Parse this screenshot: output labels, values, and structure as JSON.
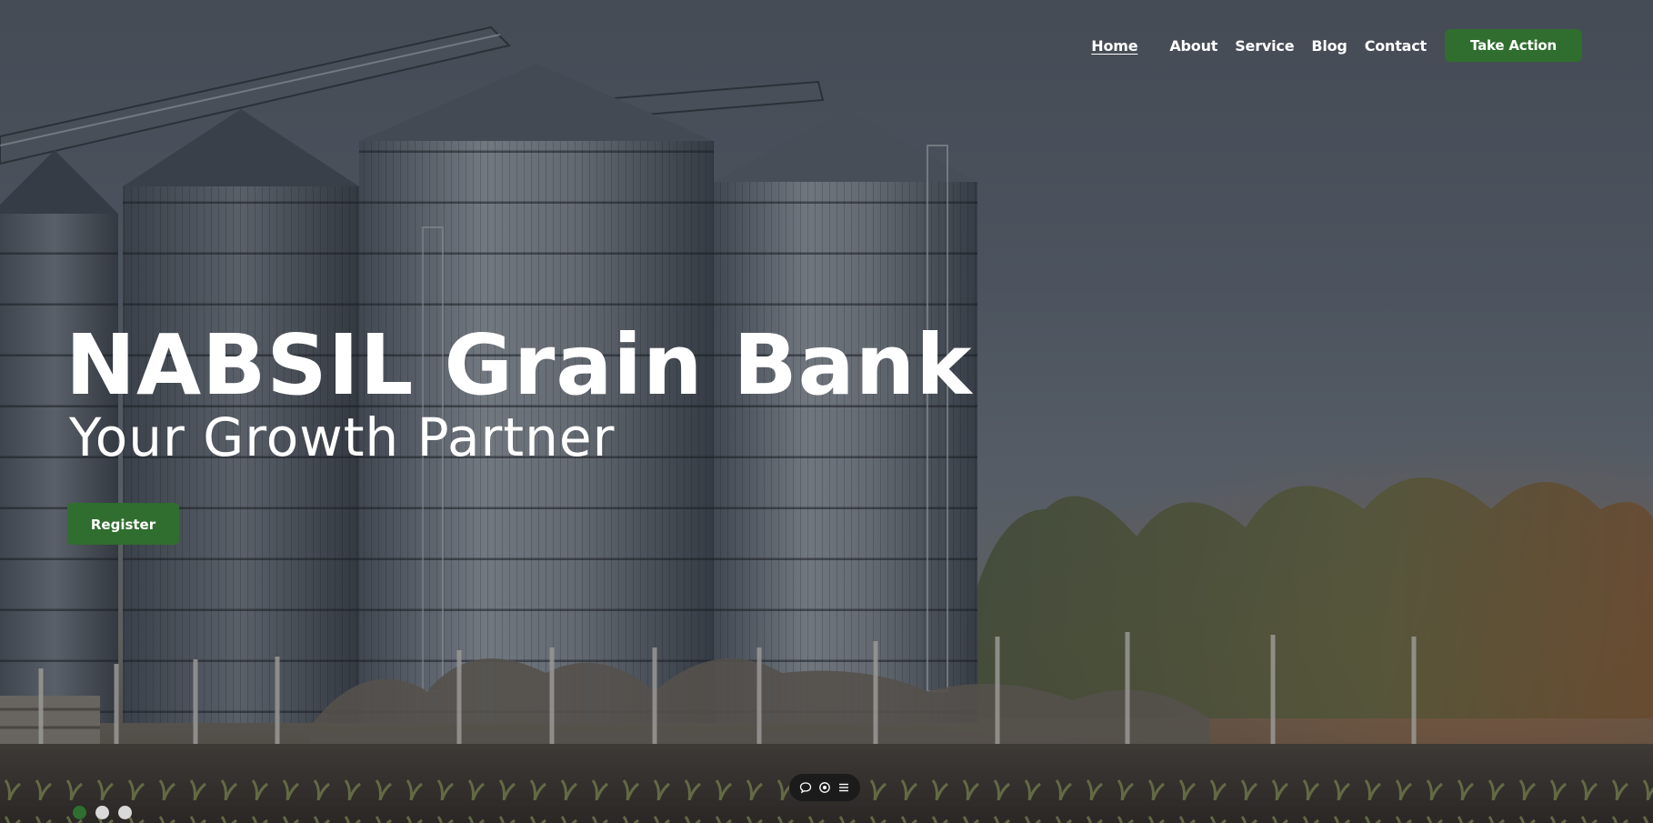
{
  "nav": {
    "items": [
      {
        "label": "Home",
        "active": true
      },
      {
        "label": "About",
        "active": false
      },
      {
        "label": "Service",
        "active": false
      },
      {
        "label": "Blog",
        "active": false
      },
      {
        "label": "Contact",
        "active": false
      }
    ],
    "cta_label": "Take Action"
  },
  "hero": {
    "title": "NABSIL Grain Bank",
    "subtitle": "Your Growth Partner",
    "register_label": "Register"
  },
  "toolbar": {
    "icons": [
      "chat-bubble-icon",
      "eye-icon",
      "menu-icon"
    ]
  },
  "slider": {
    "slide_count": 3,
    "active_index": 0
  },
  "colors": {
    "brand_green": "#2f6e2f",
    "text": "#ffffff",
    "toolbar_bg": "#1b1b1b",
    "dot_inactive": "#d9d9d9"
  }
}
